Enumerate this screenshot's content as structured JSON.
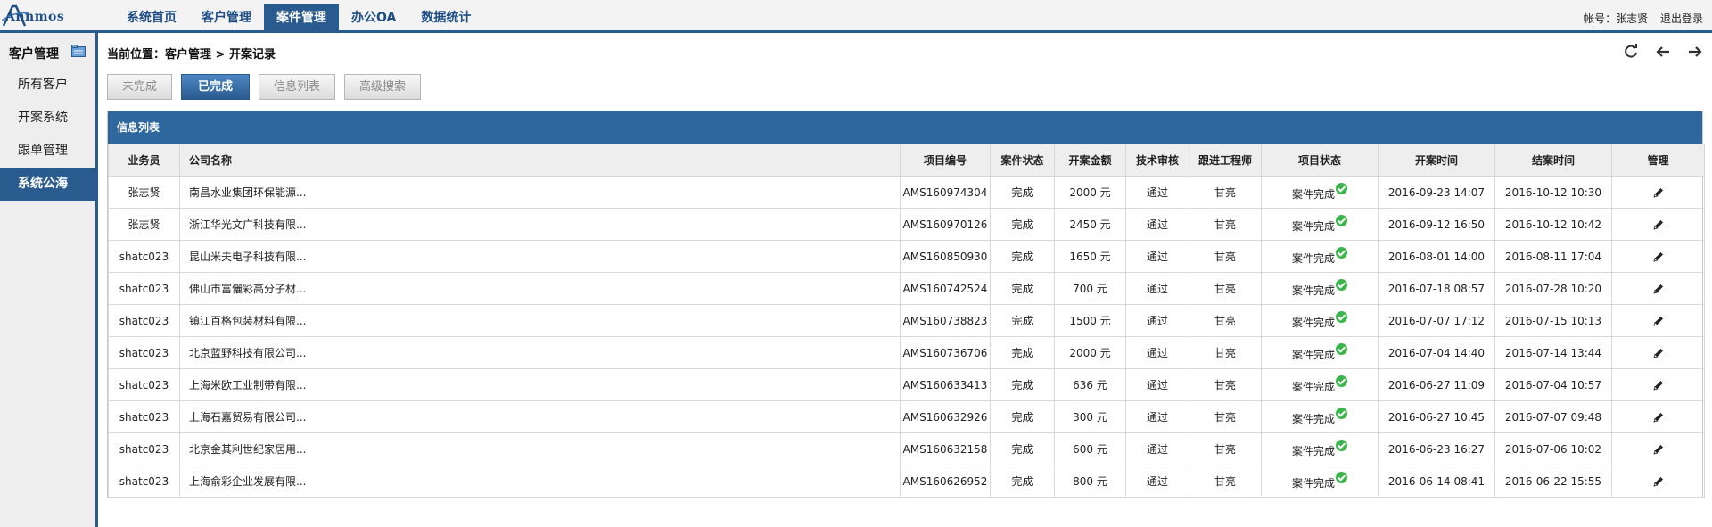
{
  "app": {
    "logo": "Annmos"
  },
  "nav": [
    {
      "label": "系统首页",
      "active": false
    },
    {
      "label": "客户管理",
      "active": false
    },
    {
      "label": "案件管理",
      "active": true
    },
    {
      "label": "办公OA",
      "active": false
    },
    {
      "label": "数据统计",
      "active": false
    }
  ],
  "account": {
    "text": "帐号：张志贤",
    "logout": "退出登录"
  },
  "sidebar": {
    "title": "客户管理",
    "items": [
      {
        "label": "所有客户",
        "active": false
      },
      {
        "label": "开案系统",
        "active": false
      },
      {
        "label": "跟单管理",
        "active": false
      },
      {
        "label": "系统公海",
        "active": true
      }
    ]
  },
  "breadcrumb": "当前位置：客户管理 > 开案记录",
  "toolbar": {
    "tools": [
      "refresh-icon",
      "arrow-left-icon",
      "arrow-right-icon"
    ],
    "buttons": [
      {
        "label": "未完成",
        "active": false
      },
      {
        "label": "已完成",
        "active": true
      },
      {
        "label": "信息列表",
        "active": false
      },
      {
        "label": "高级搜索",
        "active": false
      }
    ]
  },
  "panel": {
    "title": "信息列表"
  },
  "table": {
    "headers": [
      "业务员",
      "公司名称",
      "项目编号",
      "案件状态",
      "开案金额",
      "技术审核",
      "跟进工程师",
      "项目状态",
      "开案时间",
      "结案时间",
      "管理"
    ],
    "rows": [
      [
        "张志贤",
        "南昌水业集团环保能源...",
        "AMS160974304",
        "完成",
        "2000 元",
        "通过",
        "甘亮",
        "案件完成",
        "2016-09-23 14:07",
        "2016-10-12 10:30"
      ],
      [
        "张志贤",
        "浙江华光文广科技有限...",
        "AMS160970126",
        "完成",
        "2450 元",
        "通过",
        "甘亮",
        "案件完成",
        "2016-09-12 16:50",
        "2016-10-12 10:42"
      ],
      [
        "shatc023",
        "昆山米夫电子科技有限...",
        "AMS160850930",
        "完成",
        "1650 元",
        "通过",
        "甘亮",
        "案件完成",
        "2016-08-01 14:00",
        "2016-08-11 17:04"
      ],
      [
        "shatc023",
        "佛山市富儷彩高分子材...",
        "AMS160742524",
        "完成",
        "700 元",
        "通过",
        "甘亮",
        "案件完成",
        "2016-07-18 08:57",
        "2016-07-28 10:20"
      ],
      [
        "shatc023",
        "镇江百格包装材料有限...",
        "AMS160738823",
        "完成",
        "1500 元",
        "通过",
        "甘亮",
        "案件完成",
        "2016-07-07 17:12",
        "2016-07-15 10:13"
      ],
      [
        "shatc023",
        "北京蓝野科技有限公司...",
        "AMS160736706",
        "完成",
        "2000 元",
        "通过",
        "甘亮",
        "案件完成",
        "2016-07-04 14:40",
        "2016-07-14 13:44"
      ],
      [
        "shatc023",
        "上海米欧工业制带有限...",
        "AMS160633413",
        "完成",
        "636 元",
        "通过",
        "甘亮",
        "案件完成",
        "2016-06-27 11:09",
        "2016-07-04 10:57"
      ],
      [
        "shatc023",
        "上海石嘉贸易有限公司...",
        "AMS160632926",
        "完成",
        "300 元",
        "通过",
        "甘亮",
        "案件完成",
        "2016-06-27 10:45",
        "2016-07-07 09:48"
      ],
      [
        "shatc023",
        "北京金其利世纪家居用...",
        "AMS160632158",
        "完成",
        "600 元",
        "通过",
        "甘亮",
        "案件完成",
        "2016-06-23 16:27",
        "2016-07-06 10:02"
      ],
      [
        "shatc023",
        "上海俞彩企业发展有限...",
        "AMS160626952",
        "完成",
        "800 元",
        "通过",
        "甘亮",
        "案件完成",
        "2016-06-14 08:41",
        "2016-06-22 15:55"
      ]
    ]
  },
  "colors": {
    "primary": "#2a5b8f",
    "panel_header": "#2e679e",
    "status_ok": "#3bb54a"
  }
}
